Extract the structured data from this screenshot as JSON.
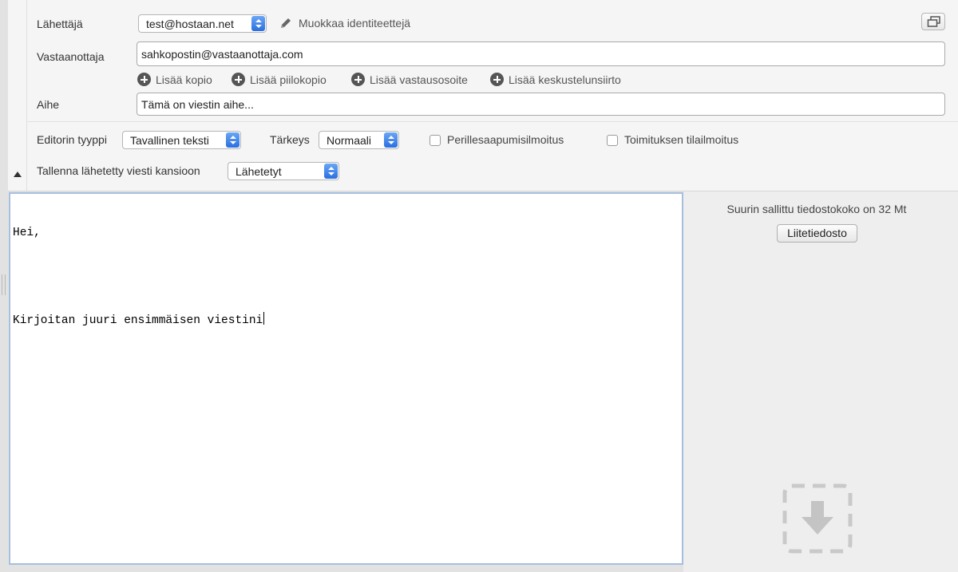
{
  "header": {
    "sender_label": "Lähettäjä",
    "sender_value": "test@hostaan.net",
    "edit_identities": "Muokkaa identiteettejä",
    "recipient_label": "Vastaanottaja",
    "recipient_value": "sahkopostin@vastaanottaja.com",
    "add_actions": [
      "Lisää kopio",
      "Lisää piilokopio",
      "Lisää vastausosoite",
      "Lisää keskustelunsiirto"
    ],
    "subject_label": "Aihe",
    "subject_value": "Tämä on viestin aihe..."
  },
  "options": {
    "editor_type_label": "Editorin tyyppi",
    "editor_type_value": "Tavallinen teksti",
    "priority_label": "Tärkeys",
    "priority_value": "Normaali",
    "return_receipt_label": "Perillesaapumisilmoitus",
    "delivery_status_label": "Toimituksen tilailmoitus",
    "save_sent_label": "Tallenna lähetetty viesti kansioon",
    "save_sent_value": "Lähetetyt"
  },
  "editor": {
    "line1": "Hei,",
    "line2": "Kirjoitan juuri ensimmäisen viestini"
  },
  "attachments": {
    "max_size": "Suurin sallittu tiedostokoko on 32 Mt",
    "button_label": "Liitetiedosto"
  },
  "icons": {
    "edit": "pencil-icon",
    "add": "plus-circle-icon",
    "window": "popout-window-icon",
    "drop": "drop-arrow-icon",
    "collapse": "triangle-up-icon"
  }
}
